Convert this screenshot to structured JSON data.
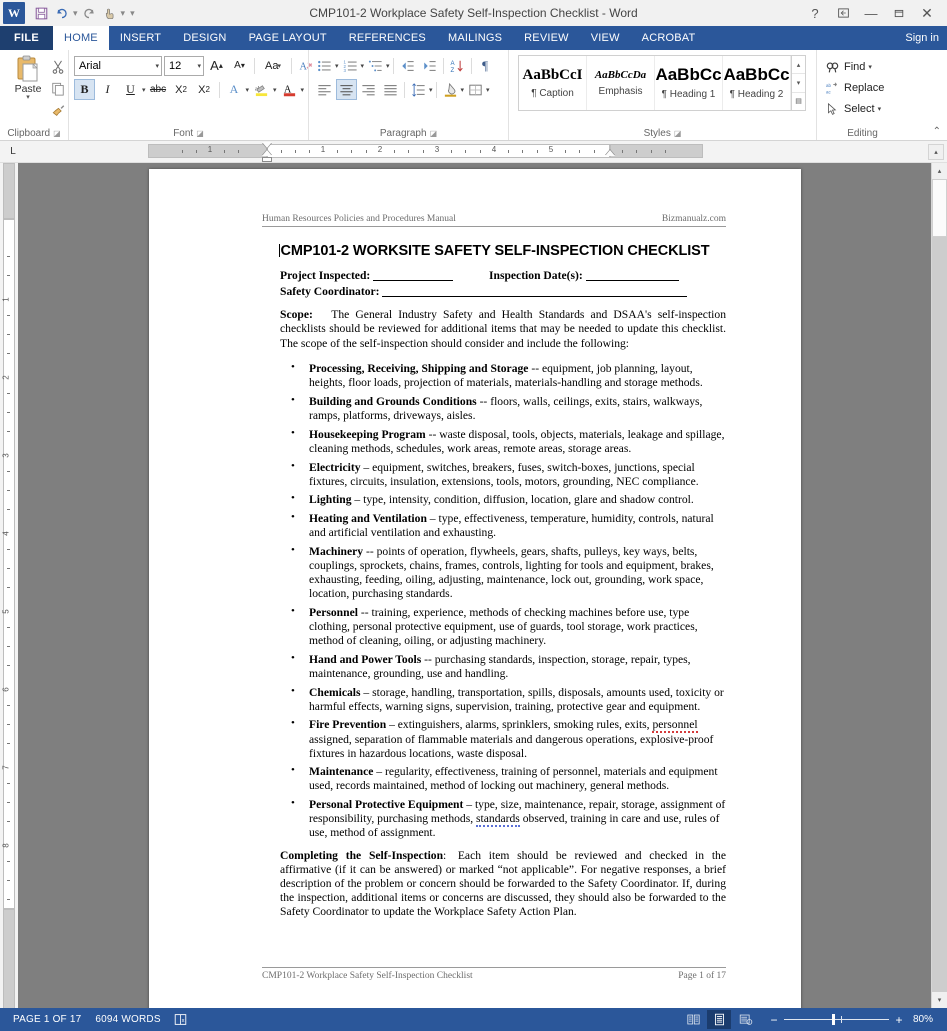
{
  "window": {
    "title": "CMP101-2 Workplace Safety Self-Inspection Checklist - Word",
    "app_logo": "W",
    "quick_access": [
      {
        "name": "save-icon",
        "label": "Save"
      },
      {
        "name": "undo-icon",
        "label": "Undo"
      },
      {
        "name": "redo-icon",
        "label": "Redo"
      },
      {
        "name": "touch-mode-icon",
        "label": "Touch/Mouse Mode"
      },
      {
        "name": "customize-qat-icon",
        "label": "Customize Quick Access Toolbar"
      }
    ],
    "controls": {
      "help": "?",
      "ribbon_display": "Ribbon Display Options",
      "minimize": "Minimize",
      "restore": "Restore Down",
      "close": "Close"
    },
    "sign_in": "Sign in"
  },
  "tabs": {
    "file": "FILE",
    "items": [
      "HOME",
      "INSERT",
      "DESIGN",
      "PAGE LAYOUT",
      "REFERENCES",
      "MAILINGS",
      "REVIEW",
      "VIEW",
      "ACROBAT"
    ],
    "active": "HOME"
  },
  "ribbon": {
    "clipboard": {
      "label": "Clipboard",
      "paste": "Paste",
      "cut": "Cut",
      "copy": "Copy",
      "format_painter": "Format Painter"
    },
    "font": {
      "label": "Font",
      "font_name": "Arial",
      "font_size": "12",
      "grow_font": "A",
      "shrink_font": "A",
      "change_case": "Aa",
      "clear_formatting": "Clear All Formatting",
      "bold": "B",
      "italic": "I",
      "underline": "U",
      "strikethrough": "abc",
      "subscript": "X",
      "superscript": "X",
      "text_effects": "A",
      "highlight": "ab",
      "font_color": "A",
      "bold_active": true
    },
    "paragraph": {
      "label": "Paragraph",
      "bullets": "Bullets",
      "numbering": "Numbering",
      "multilevel": "Multilevel List",
      "decrease_indent": "Decrease Indent",
      "increase_indent": "Increase Indent",
      "sort": "Sort",
      "show_marks": "¶",
      "align_left": "Align Left",
      "align_center": "Center",
      "align_right": "Align Right",
      "justify": "Justify",
      "line_spacing": "Line and Paragraph Spacing",
      "shading": "Shading",
      "borders": "Borders",
      "center_active": true
    },
    "styles": {
      "label": "Styles",
      "items": [
        {
          "preview": "AaBbCcI",
          "name": "¶ Caption",
          "style": "caption"
        },
        {
          "preview": "AaBbCcDa",
          "name": "Emphasis",
          "style": "emphasis"
        },
        {
          "preview": "AaBbCc",
          "name": "¶ Heading 1",
          "style": "heading1"
        },
        {
          "preview": "AaBbCc",
          "name": "¶ Heading 2",
          "style": "heading2"
        }
      ]
    },
    "editing": {
      "label": "Editing",
      "find": "Find",
      "replace": "Replace",
      "select": "Select"
    },
    "collapse": "Collapse the Ribbon"
  },
  "ruler": {
    "tab_stop": "L",
    "h_numbers": [
      "1",
      "1",
      "2",
      "3",
      "4",
      "5"
    ],
    "v_numbers": [
      "1",
      "2",
      "3",
      "4",
      "5",
      "6",
      "7",
      "8"
    ]
  },
  "document": {
    "header_left": "Human Resources Policies and Procedures Manual",
    "header_right": "Bizmanualz.com",
    "title": "CMP101-2 WORKSITE SAFETY SELF-INSPECTION CHECKLIST",
    "fields": {
      "project_inspected": "Project Inspected:",
      "inspection_dates": "Inspection Date(s):",
      "safety_coordinator": "Safety Coordinator:"
    },
    "scope_label": "Scope:",
    "scope_text": "The General Industry Safety and Health Standards and DSAA's self-inspection checklists should be reviewed for additional items that may be needed to update this checklist. The scope of the self-inspection should consider and include the following:",
    "bullets": [
      {
        "term": "Processing, Receiving, Shipping and Storage",
        "dash": " -- ",
        "text": "equipment, job planning, layout, heights, floor loads, projection of materials, materials-handling and storage methods."
      },
      {
        "term": "Building and Grounds Conditions",
        "dash": " -- ",
        "text": "floors, walls, ceilings, exits, stairs, walkways, ramps, platforms, driveways, aisles."
      },
      {
        "term": "Housekeeping Program",
        "dash": " -- ",
        "text": "waste disposal, tools, objects, materials, leakage and spillage, cleaning methods, schedules, work areas, remote areas, storage areas."
      },
      {
        "term": "Electricity",
        "dash": " – ",
        "text": "equipment, switches, breakers, fuses, switch-boxes, junctions, special fixtures, circuits, insulation, extensions, tools, motors, grounding, NEC compliance."
      },
      {
        "term": "Lighting",
        "dash": " – ",
        "text": "type, intensity, condition, diffusion, location, glare and shadow control."
      },
      {
        "term": "Heating and Ventilation",
        "dash": " – ",
        "text": "type, effectiveness, temperature, humidity, controls, natural and artificial ventilation and exhausting."
      },
      {
        "term": "Machinery",
        "dash": " -- ",
        "text": "points of operation, flywheels, gears, shafts, pulleys, key ways, belts, couplings, sprockets, chains, frames, controls, lighting for tools and equipment, brakes, exhausting, feeding, oiling, adjusting, maintenance, lock out, grounding, work space, location, purchasing standards."
      },
      {
        "term": "Personnel",
        "dash": " -- ",
        "text": "training, experience, methods of checking machines before use, type clothing, personal protective equipment, use of guards, tool storage, work practices, method of cleaning, oiling, or adjusting machinery."
      },
      {
        "term": "Hand and Power Tools",
        "dash": " -- ",
        "text": "purchasing standards, inspection, storage, repair, types, maintenance, grounding, use and handling."
      },
      {
        "term": "Chemicals",
        "dash": " – ",
        "text": "storage, handling, transportation, spills, disposals, amounts used, toxicity or harmful effects, warning signs, supervision, training, protective gear and equipment."
      },
      {
        "term": "Fire Prevention",
        "dash": " – ",
        "text_before": "extinguishers, alarms, sprinklers, smoking rules, exits, ",
        "misspelled": "personnel",
        "misspell_type": "spelling",
        "text_after": " assigned, separation of flammable materials and dangerous operations, explosive-proof fixtures in hazardous locations, waste disposal."
      },
      {
        "term": "Maintenance",
        "dash": " – ",
        "text": "regularity, effectiveness, training of personnel, materials and equipment used, records maintained, method of locking out machinery, general methods."
      },
      {
        "term": "Personal Protective Equipment",
        "dash": " – ",
        "text_before": "type, size, maintenance, repair, storage, assignment of responsibility, purchasing methods, ",
        "misspelled": "standards",
        "misspell_type": "grammar",
        "text_after": " observed, training in care and use, rules of use, method of assignment."
      }
    ],
    "completing_label": "Completing the Self-Inspection",
    "completing_text": ": Each item should be reviewed and checked in the affirmative (if it can be answered) or marked “not applicable”.  For negative responses, a brief description of the problem or concern should be forwarded to the Safety Coordinator.  If, during the inspection, additional items or concerns are discussed, they should also be forwarded to the Safety Coordinator to update the Workplace Safety Action Plan.",
    "footer_left": "CMP101-2 Workplace Safety Self-Inspection Checklist",
    "footer_right": "Page 1 of 17"
  },
  "status_bar": {
    "page": "PAGE 1 OF 17",
    "words": "6094 WORDS",
    "proofing": "Proofing errors",
    "views": [
      {
        "name": "read-mode-icon",
        "label": "Read Mode",
        "selected": false
      },
      {
        "name": "print-layout-icon",
        "label": "Print Layout",
        "selected": true
      },
      {
        "name": "web-layout-icon",
        "label": "Web Layout",
        "selected": false
      }
    ],
    "zoom_out": "−",
    "zoom_in": "+",
    "zoom_level": "80%"
  },
  "colors": {
    "accent": "#2b579a",
    "file_tab": "#1e3f6f",
    "canvas": "#7f7f7f",
    "spell_error": "#d43b3b",
    "grammar_error": "#5b6fd6"
  }
}
